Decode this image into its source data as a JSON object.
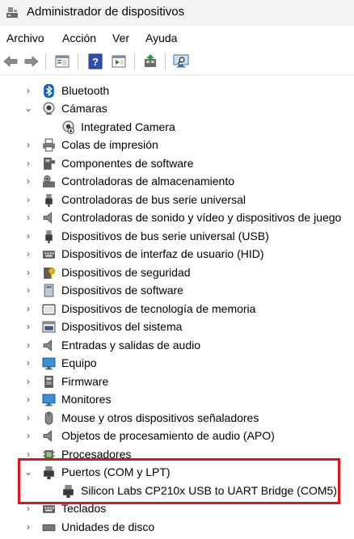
{
  "window": {
    "title": "Administrador de dispositivos"
  },
  "menu": [
    "Archivo",
    "Acción",
    "Ver",
    "Ayuda"
  ],
  "toolbar": {
    "buttons": [
      "back-arrow-icon",
      "forward-arrow-icon",
      "properties-icon",
      "help-icon",
      "run-icon",
      "update-driver-icon",
      "scan-hardware-icon"
    ]
  },
  "tree": {
    "items": [
      {
        "label": "Bluetooth",
        "expanded": false,
        "icon": "bluetooth-icon"
      },
      {
        "label": "Cámaras",
        "expanded": true,
        "icon": "camera-icon"
      },
      {
        "label": "Integrated Camera",
        "child": true,
        "icon": "webcam-icon"
      },
      {
        "label": "Colas de impresión",
        "expanded": false,
        "icon": "printer-icon"
      },
      {
        "label": "Componentes de software",
        "expanded": false,
        "icon": "puzzle-icon"
      },
      {
        "label": "Controladoras de almacenamiento",
        "expanded": false,
        "icon": "storage-controller-icon"
      },
      {
        "label": "Controladoras de bus serie universal",
        "expanded": false,
        "icon": "usb-plug-icon"
      },
      {
        "label": "Controladoras de sonido y vídeo y dispositivos de juego",
        "expanded": false,
        "icon": "speaker-icon"
      },
      {
        "label": "Dispositivos de bus serie universal (USB)",
        "expanded": false,
        "icon": "usb-plug-icon"
      },
      {
        "label": "Dispositivos de interfaz de usuario (HID)",
        "expanded": false,
        "icon": "keyboard-icon"
      },
      {
        "label": "Dispositivos de seguridad",
        "expanded": false,
        "icon": "security-key-icon"
      },
      {
        "label": "Dispositivos de software",
        "expanded": false,
        "icon": "software-device-icon"
      },
      {
        "label": "Dispositivos de tecnología de memoria",
        "expanded": false,
        "icon": "memory-icon"
      },
      {
        "label": "Dispositivos del sistema",
        "expanded": false,
        "icon": "system-folder-icon"
      },
      {
        "label": "Entradas y salidas de audio",
        "expanded": false,
        "icon": "speaker-icon"
      },
      {
        "label": "Equipo",
        "expanded": false,
        "icon": "computer-icon"
      },
      {
        "label": "Firmware",
        "expanded": false,
        "icon": "firmware-icon"
      },
      {
        "label": "Monitores",
        "expanded": false,
        "icon": "monitor-icon"
      },
      {
        "label": "Mouse y otros dispositivos señaladores",
        "expanded": false,
        "icon": "mouse-icon"
      },
      {
        "label": "Objetos de procesamiento de audio (APO)",
        "expanded": false,
        "icon": "speaker-icon"
      },
      {
        "label": "Procesadores",
        "expanded": false,
        "icon": "processor-icon"
      },
      {
        "label": "Puertos (COM y LPT)",
        "expanded": true,
        "icon": "port-icon"
      },
      {
        "label": "Silicon Labs CP210x USB to UART Bridge (COM5)",
        "child": true,
        "icon": "port-icon"
      },
      {
        "label": "Teclados",
        "expanded": false,
        "icon": "keyboard-icon"
      },
      {
        "label": "Unidades de disco",
        "expanded": false,
        "icon": "disk-drive-icon"
      }
    ]
  },
  "colors": {
    "highlight": "#e0151b",
    "titlebar": "#f3f3f3"
  }
}
